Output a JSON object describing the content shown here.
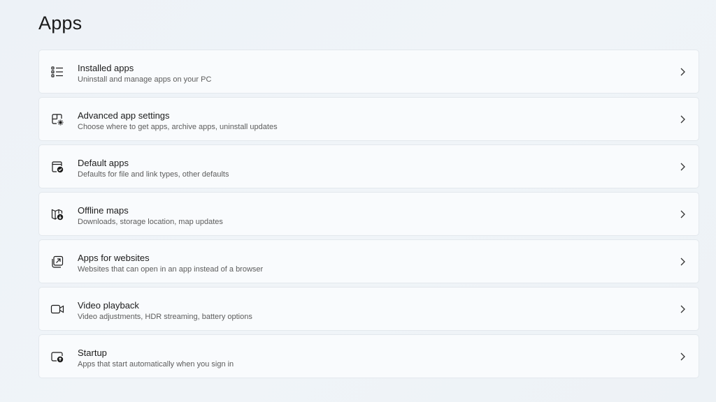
{
  "page": {
    "title": "Apps"
  },
  "items": [
    {
      "label": "Installed apps",
      "description": "Uninstall and manage apps on your PC",
      "icon": "list-icon"
    },
    {
      "label": "Advanced app settings",
      "description": "Choose where to get apps, archive apps, uninstall updates",
      "icon": "app-settings-icon"
    },
    {
      "label": "Default apps",
      "description": "Defaults for file and link types, other defaults",
      "icon": "default-apps-icon"
    },
    {
      "label": "Offline maps",
      "description": "Downloads, storage location, map updates",
      "icon": "map-download-icon"
    },
    {
      "label": "Apps for websites",
      "description": "Websites that can open in an app instead of a browser",
      "icon": "open-external-icon"
    },
    {
      "label": "Video playback",
      "description": "Video adjustments, HDR streaming, battery options",
      "icon": "video-camera-icon"
    },
    {
      "label": "Startup",
      "description": "Apps that start automatically when you sign in",
      "icon": "startup-icon"
    }
  ],
  "colors": {
    "background": "#eef3f8",
    "card": "#f9fbfd",
    "text": "#1b1b1b",
    "secondary_text": "#5c5c5c"
  }
}
